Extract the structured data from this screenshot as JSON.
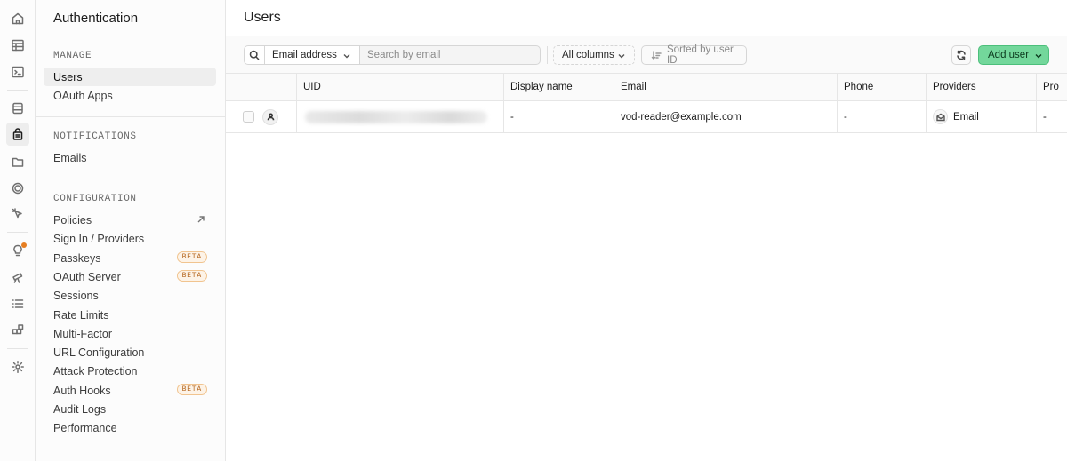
{
  "sidebar": {
    "title": "Authentication",
    "sections": [
      {
        "label": "MANAGE",
        "items": [
          {
            "label": "Users",
            "active": true
          },
          {
            "label": "OAuth Apps"
          }
        ]
      },
      {
        "label": "NOTIFICATIONS",
        "items": [
          {
            "label": "Emails"
          }
        ]
      },
      {
        "label": "CONFIGURATION",
        "items": [
          {
            "label": "Policies",
            "external": true
          },
          {
            "label": "Sign In / Providers"
          },
          {
            "label": "Passkeys",
            "badge": "BETA"
          },
          {
            "label": "OAuth Server",
            "badge": "BETA"
          },
          {
            "label": "Sessions"
          },
          {
            "label": "Rate Limits"
          },
          {
            "label": "Multi-Factor"
          },
          {
            "label": "URL Configuration"
          },
          {
            "label": "Attack Protection"
          },
          {
            "label": "Auth Hooks",
            "badge": "BETA"
          },
          {
            "label": "Audit Logs"
          },
          {
            "label": "Performance"
          }
        ]
      }
    ]
  },
  "rail": {
    "icons": [
      "home-icon",
      "table-editor-icon",
      "sql-editor-icon",
      "database-icon",
      "authentication-icon",
      "storage-icon",
      "realtime-icon",
      "edge-functions-icon",
      "advisors-icon",
      "reports-icon",
      "logs-icon",
      "integrations-icon",
      "settings-icon"
    ],
    "notification_color": "#e67e22"
  },
  "main": {
    "title": "Users",
    "toolbar": {
      "field_select": "Email address",
      "search_placeholder": "Search by email",
      "columns_button": "All columns",
      "sort_button": "Sorted by user ID",
      "add_button": "Add user",
      "add_button_color": "#73d79b"
    },
    "table": {
      "columns": [
        "UID",
        "Display name",
        "Email",
        "Phone",
        "Providers",
        "Pro"
      ],
      "rows": [
        {
          "uid": "",
          "display_name": "-",
          "email": "vod-reader@example.com",
          "phone": "-",
          "provider": "Email",
          "pro": "-"
        }
      ]
    }
  }
}
